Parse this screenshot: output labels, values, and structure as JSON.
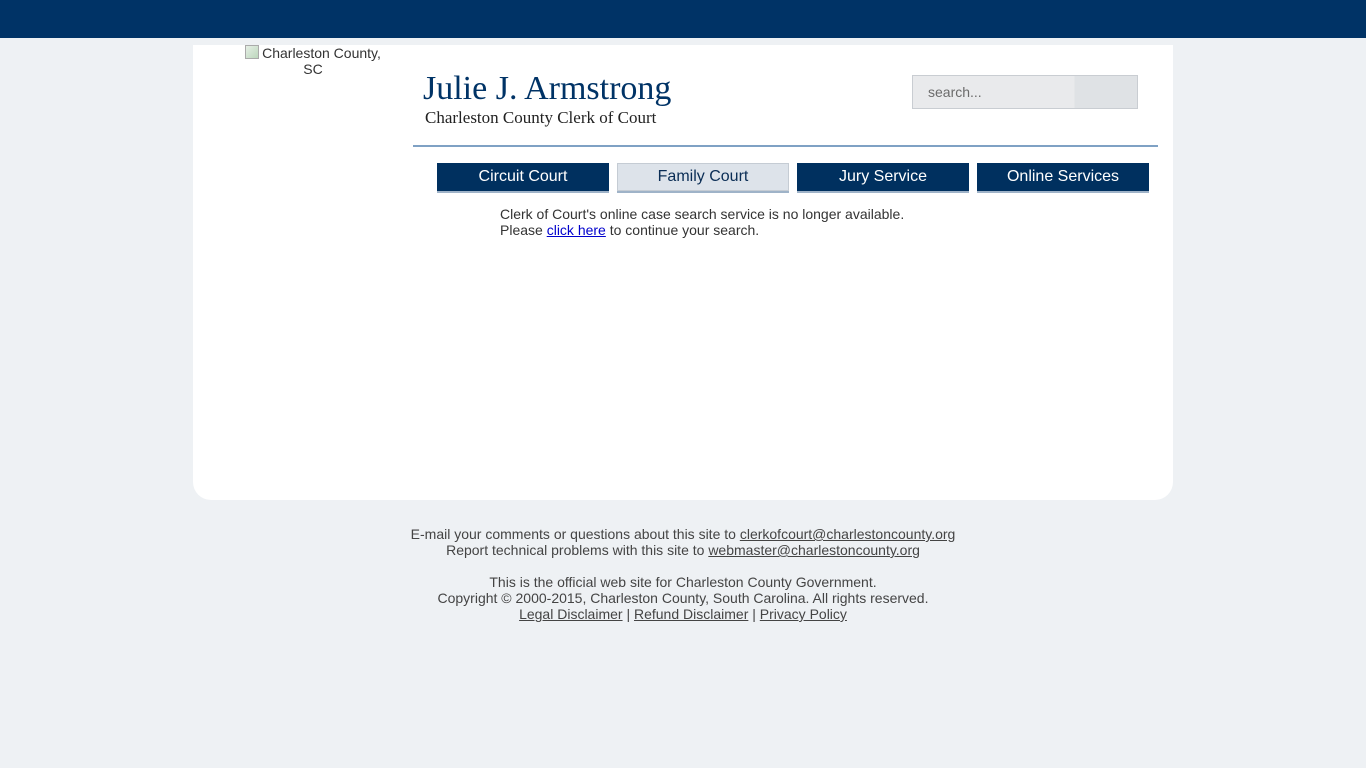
{
  "logo": {
    "alt_text": "Charleston County, SC"
  },
  "header": {
    "title": "Julie J. Armstrong",
    "subtitle": "Charleston County Clerk of Court",
    "search_placeholder": "search..."
  },
  "nav": [
    {
      "label": "Circuit Court"
    },
    {
      "label": "Family Court"
    },
    {
      "label": "Jury Service"
    },
    {
      "label": "Online Services"
    }
  ],
  "message": {
    "line1": "Clerk of Court's online case search service is no longer available.",
    "line2_prefix": "Please ",
    "link_text": "click here",
    "line2_suffix": " to continue your search."
  },
  "footer": {
    "comments_prefix": "E-mail your comments or questions about this site to ",
    "comments_email": "clerkofcourt@charlestoncounty.org",
    "tech_prefix": "Report technical problems with this site to ",
    "tech_email": "webmaster@charlestoncounty.org",
    "official": "This is the official web site for Charleston County Government.",
    "copyright": "Copyright © 2000-2015, Charleston County, South Carolina. All rights reserved.",
    "legal_link": "Legal Disclaimer",
    "refund_link": "Refund Disclaimer",
    "privacy_link": "Privacy Policy",
    "separator": " | "
  },
  "colors": {
    "topbar": "#003366",
    "nav_dark": "#00305f",
    "nav_light": "#dde3ea",
    "page_bg": "#eef1f4"
  }
}
